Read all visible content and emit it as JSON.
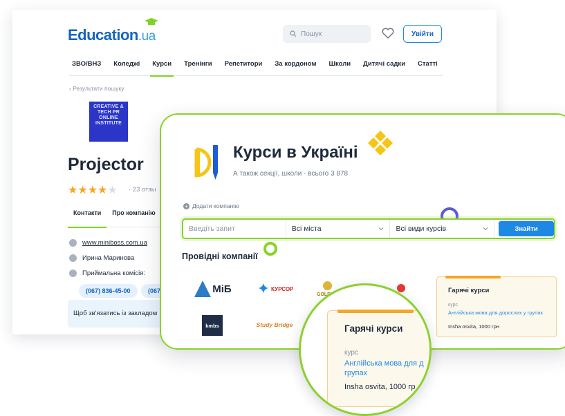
{
  "site": {
    "logo_main": "Education",
    "logo_suffix": ".ua",
    "search_placeholder": "Пошук",
    "login_label": "Увійти",
    "nav": [
      "ЗВО/ВНЗ",
      "Коледжі",
      "Курси",
      "Тренінги",
      "Репетитори",
      "За кордоном",
      "Школи",
      "Дитячі садки",
      "Статті"
    ],
    "active_nav": "Курси",
    "breadcrumb": "‹ Результати пошуку"
  },
  "company": {
    "logo_text": "CREATIVE & TECH PR ONLINE INSTITUTE",
    "name": "Projector",
    "rating_stars": 4,
    "reviews": "· 23 отзы",
    "tabs": [
      "Контакти",
      "Про компанію"
    ],
    "website": "www.miniboss.com.ua",
    "contact_person": "Ирина Маринова",
    "commission_label": "Приймальна комісія:",
    "phones": [
      "(067) 836-45-00",
      "(067"
    ],
    "notice": "Щоб зв'язатись із закладом"
  },
  "courses_page": {
    "title": "Курси в Україні",
    "subtitle": "А також секції, школи · всього 3 878",
    "add_company": "Додати компанію",
    "query_placeholder": "Введіть запит",
    "city_value": "Всі міста",
    "kind_value": "Всі види курсів",
    "find_label": "Знайти",
    "leaders_title": "Провідні компанії",
    "leader_logos": [
      "МіБ",
      "КУРСОР",
      "GOLDEN",
      "",
      "kmbs",
      "Study Bridge"
    ]
  },
  "hot_course": {
    "heading": "Гарячі курси",
    "kind": "курс",
    "link": "Англійська мова для дорослих у групах",
    "price": "Insha osvita, 1000 грн"
  },
  "lens_course": {
    "heading": "Гарячі курси",
    "kind": "курс",
    "link": "Англійська мова для д групах",
    "price": "Insha osvita, 1000 гр"
  },
  "colors": {
    "brand_blue": "#1565c0",
    "accent_green": "#8bd12b",
    "button_blue": "#1e88e5",
    "star_orange": "#f5a623"
  }
}
